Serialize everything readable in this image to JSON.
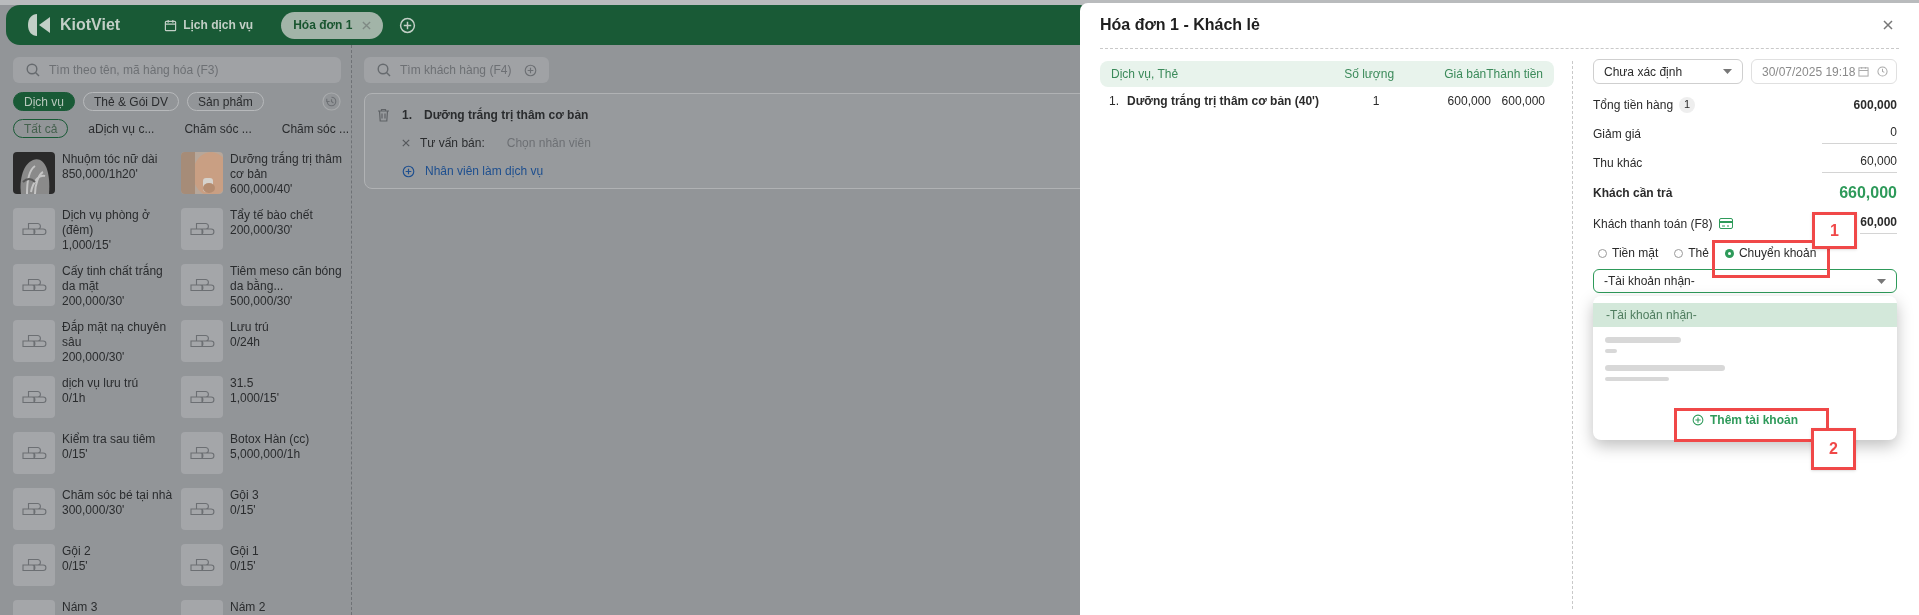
{
  "header": {
    "logo": "KiotViet",
    "tabs": [
      {
        "label": "Lịch dịch vụ",
        "selected": false,
        "kind": "calendar"
      },
      {
        "label": "Hóa đơn 1",
        "selected": true,
        "kind": "invoice"
      }
    ]
  },
  "left_panel": {
    "search": {
      "placeholder": "Tìm theo tên, mã hàng hóa (F3)"
    },
    "categories": [
      {
        "label": "Dịch vụ",
        "selected": true
      },
      {
        "label": "Thẻ & Gói DV",
        "selected": false
      },
      {
        "label": "Sản phẩm",
        "selected": false
      }
    ],
    "subcategories": [
      {
        "label": "Tất cả",
        "selected": true
      },
      {
        "label": "aDịch vụ c...",
        "selected": false
      },
      {
        "label": "Chăm sóc ...",
        "selected": false
      },
      {
        "label": "Chăm sóc ...",
        "selected": false
      }
    ],
    "products": [
      {
        "name": "Nhuộm tóc nữ dài",
        "price": "850,000/1h20'"
      },
      {
        "name": "Dưỡng trắng trị thâm cơ bản",
        "price": "600,000/40'"
      },
      {
        "name": "Dịch vụ phòng ở (đêm)",
        "price": "1,000/15'",
        "kind": "placeholder"
      },
      {
        "name": "Tẩy tế bào chết",
        "price": "200,000/30'",
        "kind": "placeholder"
      },
      {
        "name": "Cấy tinh chất trắng da mặt",
        "price": "200,000/30'",
        "kind": "placeholder"
      },
      {
        "name": "Tiêm meso căn bóng da bằng...",
        "price": "500,000/30'",
        "kind": "placeholder"
      },
      {
        "name": "Đắp mặt nạ chuyên sâu",
        "price": "200,000/30'",
        "kind": "placeholder"
      },
      {
        "name": "Lưu trú",
        "price": "0/24h",
        "kind": "placeholder"
      },
      {
        "name": "dịch vụ lưu trú",
        "price": "0/1h",
        "kind": "placeholder"
      },
      {
        "name": "31.5",
        "price": "1,000/15'",
        "kind": "placeholder"
      },
      {
        "name": "Kiểm tra sau tiêm",
        "price": "0/15'",
        "kind": "placeholder"
      },
      {
        "name": "Botox Hàn (cc)",
        "price": "5,000,000/1h",
        "kind": "placeholder"
      },
      {
        "name": "Chăm sóc bé tại nhà",
        "price": "300,000/30'",
        "kind": "placeholder"
      },
      {
        "name": "Gội 3",
        "price": "0/15'",
        "kind": "placeholder"
      },
      {
        "name": "Gội 2",
        "price": "0/15'",
        "kind": "placeholder"
      },
      {
        "name": "Gội 1",
        "price": "0/15'",
        "kind": "placeholder"
      },
      {
        "name": "Nám 3",
        "kind": "placeholder"
      },
      {
        "name": "Nám 2",
        "kind": "placeholder"
      }
    ]
  },
  "order_panel": {
    "customer_search": {
      "placeholder": "Tìm khách hàng (F4)"
    },
    "items": [
      {
        "index": "1.",
        "name": "Dưỡng trắng trị thâm cơ bản",
        "consultant_label": "Tư vấn bán:",
        "consultant_placeholder": "Chọn nhân viên",
        "add_staff": "Nhân viên làm dịch vụ"
      }
    ]
  },
  "modal": {
    "title": "Hóa đơn 1 - Khách lẻ",
    "table": {
      "columns": [
        "Dịch vụ, Thẻ",
        "Số lượng",
        "Giá bán",
        "Thành tiền"
      ],
      "rows": [
        {
          "index": "1.",
          "name": "Dưỡng trắng trị thâm cơ bản (40')",
          "quantity": "1",
          "price": "600,000",
          "total": "600,000"
        }
      ]
    },
    "status": "Chưa xác định",
    "datetime": "30/07/2025 19:18",
    "summary": [
      {
        "label": "Tổng tiền hàng",
        "badge": "1",
        "value": "600,000",
        "kind": "total"
      },
      {
        "label": "Giảm giá",
        "value": "0",
        "kind": "input"
      },
      {
        "label": "Thu khác",
        "value": "60,000",
        "kind": "input"
      },
      {
        "label": "Khách cần trả",
        "value": "660,000",
        "kind": "due"
      },
      {
        "label": "Khách thanh toán (F8)",
        "value": "60,000",
        "kind": "payment"
      }
    ],
    "payment_methods": [
      {
        "label": "Tiền mặt",
        "selected": false
      },
      {
        "label": "Thẻ",
        "selected": false
      },
      {
        "label": "Chuyển khoản",
        "selected": true
      }
    ],
    "account_select": {
      "placeholder": "-Tài khoản nhận-"
    },
    "account_dropdown": {
      "options": [
        {
          "label": "-Tài khoản nhận-",
          "selected": true
        }
      ],
      "add_button": "Thêm tài khoản"
    }
  },
  "callouts": [
    {
      "label": "1"
    },
    {
      "label": "2"
    }
  ]
}
